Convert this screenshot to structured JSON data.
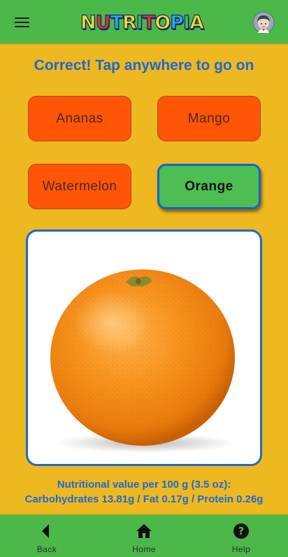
{
  "app": {
    "logo_letters": [
      {
        "ch": "N",
        "color": "#F4D82A"
      },
      {
        "ch": "U",
        "color": "#E3312E"
      },
      {
        "ch": "T",
        "color": "#34A7DA"
      },
      {
        "ch": "R",
        "color": "#F4D82A"
      },
      {
        "ch": "I",
        "color": "#4CB84A"
      },
      {
        "ch": "T",
        "color": "#E3312E"
      },
      {
        "ch": "O",
        "color": "#F4D82A"
      },
      {
        "ch": "P",
        "color": "#34A7DA"
      },
      {
        "ch": "I",
        "color": "#4CB84A"
      },
      {
        "ch": "A",
        "color": "#F4D82A"
      }
    ],
    "header_icons": {
      "menu": "menu-icon",
      "profile": "avatar"
    }
  },
  "quiz": {
    "feedback": "Correct! Tap anywhere to go on",
    "answers": [
      {
        "label": "Ananas",
        "state": "wrong"
      },
      {
        "label": "Mango",
        "state": "wrong"
      },
      {
        "label": "Watermelon",
        "state": "wrong"
      },
      {
        "label": "Orange",
        "state": "correct"
      }
    ]
  },
  "nutrition": {
    "line1": "Nutritional value per 100 g (3.5 oz):",
    "line2": "Carbohydrates 13.81g / Fat 0.17g / Protein 0.26g"
  },
  "nav": [
    {
      "label": "Back",
      "icon": "back-icon"
    },
    {
      "label": "Home",
      "icon": "home-icon"
    },
    {
      "label": "Help",
      "icon": "help-icon"
    }
  ],
  "colors": {
    "background": "#EDB820",
    "bar": "#4CB84A",
    "accent_blue": "#1E67D6",
    "answer_button": "#FE5507",
    "correct_button": "#4DBE54"
  }
}
